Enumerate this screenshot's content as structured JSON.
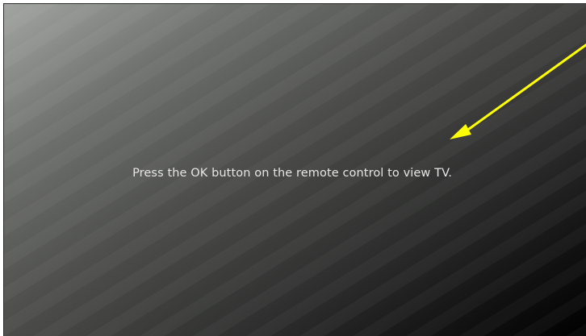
{
  "screen": {
    "message": "Press the OK button on the remote control to view TV."
  },
  "annotation": {
    "arrow_color": "#ffff00",
    "icon": "pointer-arrow-icon"
  },
  "colors": {
    "text": "#e6e6e6",
    "background_light": "#a3a5a2",
    "background_dark": "#000000"
  }
}
